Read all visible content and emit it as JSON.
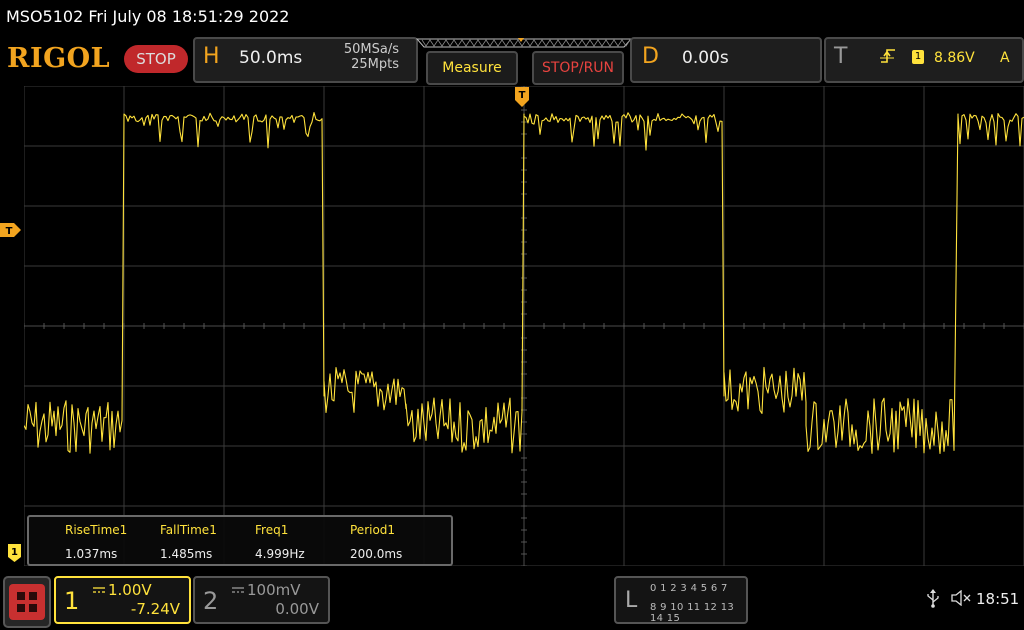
{
  "title_bar": {
    "text": "MSO5102  Fri July 08 18:51:29 2022"
  },
  "top_bar": {
    "logo": "RIGOL",
    "run_state": "STOP",
    "horizontal": {
      "letter": "H",
      "timebase": "50.0ms",
      "sample_rate": "50MSa/s",
      "memory_depth": "25Mpts"
    },
    "measure_label": "Measure",
    "stop_run_label": "STOP/RUN",
    "delay": {
      "letter": "D",
      "value": "0.00s"
    },
    "trigger": {
      "letter": "T",
      "slope_icon": "rising-edge-icon",
      "source": "1",
      "level": "8.86V",
      "mode": "A"
    }
  },
  "screen": {
    "trigger_marker": "T",
    "channel_marker": "1",
    "trace_color": "#ffe23c"
  },
  "measurements": [
    {
      "label": "RiseTime1",
      "value": "1.037ms"
    },
    {
      "label": "FallTime1",
      "value": "1.485ms"
    },
    {
      "label": "Freq1",
      "value": "4.999Hz"
    },
    {
      "label": "Period1",
      "value": "200.0ms"
    }
  ],
  "bottom_bar": {
    "ch1": {
      "num": "1",
      "scale": "1.00V",
      "offset": "-7.24V",
      "color": "#ffe23c"
    },
    "ch2": {
      "num": "2",
      "scale": "100mV",
      "offset": "0.00V"
    },
    "la": {
      "letter": "L",
      "row1": "0 1 2 3   4 5 6 7",
      "row2": "8 9 10 11  12 13 14 15"
    },
    "usb_icon": "usb-icon",
    "sound_icon": "speaker-muted-icon",
    "time": "18:51"
  }
}
